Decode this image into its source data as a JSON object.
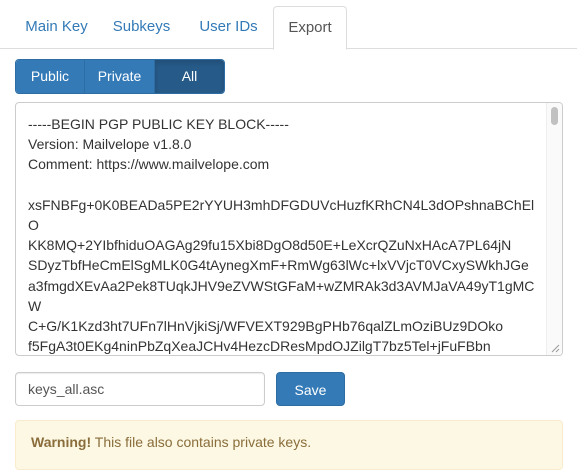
{
  "tabs": [
    {
      "label": "Main Key",
      "active": false
    },
    {
      "label": "Subkeys",
      "active": false
    },
    {
      "label": "User IDs",
      "active": false
    },
    {
      "label": "Export",
      "active": true
    }
  ],
  "export_type": {
    "options": [
      "Public",
      "Private",
      "All"
    ],
    "selected": "All"
  },
  "key_block": {
    "lines": [
      "-----BEGIN PGP PUBLIC KEY BLOCK-----",
      "Version: Mailvelope v1.8.0",
      "Comment: https://www.mailvelope.com",
      "",
      "xsFNBFg+0K0BEADa5PE2rYYUH3mhDFGDUVcHuzfKRhCN4L3dOPshnaBChEl",
      "O",
      "KK8MQ+2YIbfhiduOAGAg29fu15Xbi8DgO8d50E+LeXcrQZuNxHAcA7PL64jN",
      "SDyzTbfHeCmElSgMLK0G4tAynegXmF+RmWg63lWc+lxVVjcT0VCxySWkhJGe",
      "a3fmgdXEvAa2Pek8TUqkJHV9eZVWStGFaM+wZMRAk3d3AVMJaVA49yT1gMC",
      "W",
      "C+G/K1Kzd3ht7UFn7lHnVjkiSj/WFVEXT929BgPHb76qalZLmOziBUz9DOko",
      "f5FgA3t0EKg4ninPbZqXeaJCHv4HezcDResMpdOJZilgT7bz5Tel+jFuFBbn"
    ]
  },
  "filename": {
    "value": "keys_all.asc"
  },
  "save_label": "Save",
  "warning": {
    "strong": "Warning!",
    "text": " This file also contains private keys."
  }
}
